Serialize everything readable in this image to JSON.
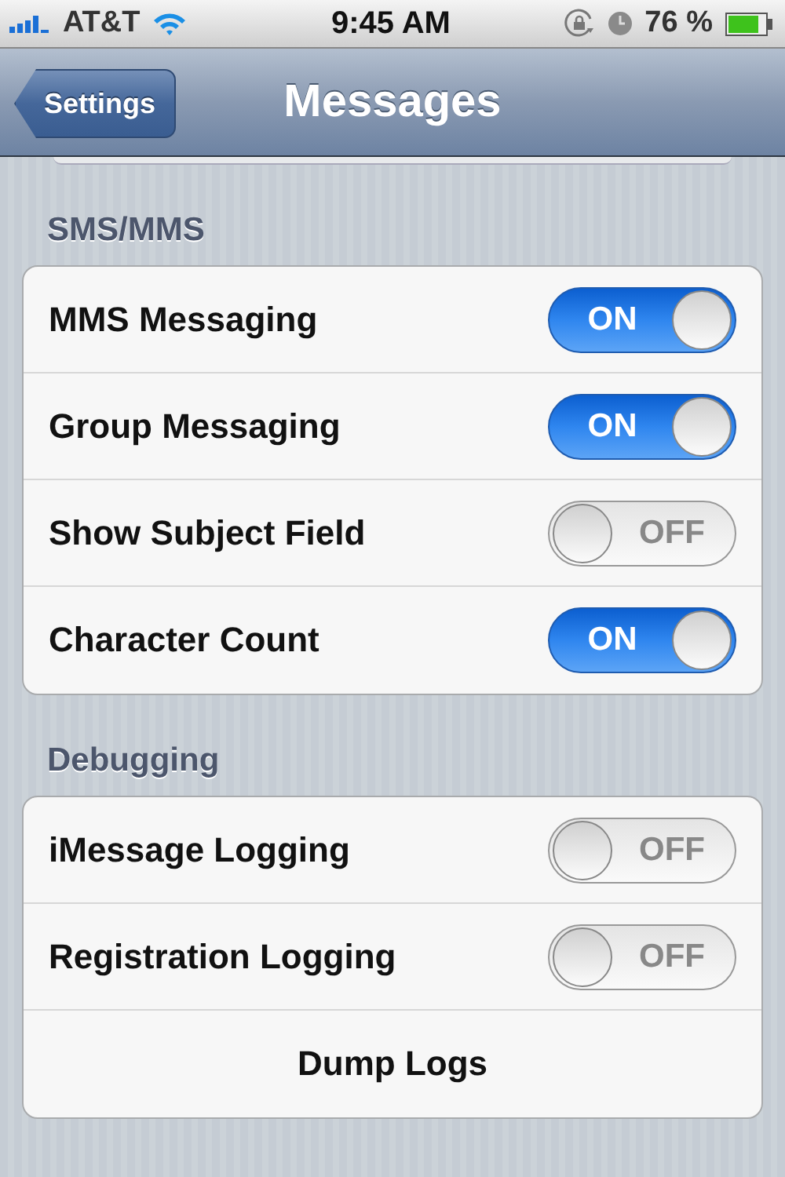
{
  "status_bar": {
    "carrier": "AT&T",
    "time": "9:45 AM",
    "battery": "76 %"
  },
  "nav": {
    "back": "Settings",
    "title": "Messages"
  },
  "sections": [
    {
      "header": "SMS/MMS",
      "rows": [
        {
          "kind": "toggle",
          "label": "MMS Messaging",
          "on": true,
          "state_text": "ON"
        },
        {
          "kind": "toggle",
          "label": "Group Messaging",
          "on": true,
          "state_text": "ON"
        },
        {
          "kind": "toggle",
          "label": "Show Subject Field",
          "on": false,
          "state_text": "OFF"
        },
        {
          "kind": "toggle",
          "label": "Character Count",
          "on": true,
          "state_text": "ON"
        }
      ]
    },
    {
      "header": "Debugging",
      "rows": [
        {
          "kind": "toggle",
          "label": "iMessage Logging",
          "on": false,
          "state_text": "OFF"
        },
        {
          "kind": "toggle",
          "label": "Registration Logging",
          "on": false,
          "state_text": "OFF"
        },
        {
          "kind": "button",
          "label": "Dump Logs"
        }
      ]
    }
  ]
}
